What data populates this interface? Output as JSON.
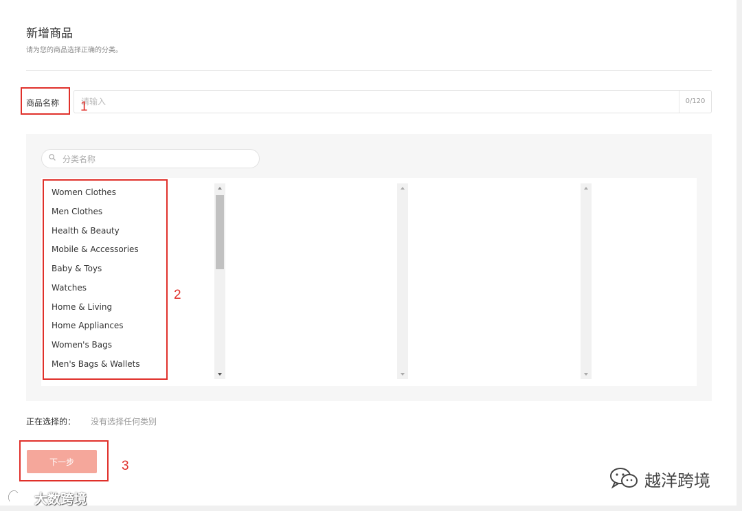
{
  "page": {
    "title": "新增商品",
    "subtitle": "请为您的商品选择正确的分类。"
  },
  "product_name": {
    "label": "商品名称",
    "placeholder": "请输入",
    "value": "",
    "counter": "0/120"
  },
  "category": {
    "search_placeholder": "分类名称",
    "items": [
      {
        "label": "Women Clothes",
        "icon": "chevron-right-icon"
      },
      {
        "label": "Men Clothes",
        "icon": "chevron-right-icon"
      },
      {
        "label": "Health & Beauty",
        "icon": "chevron-right-icon"
      },
      {
        "label": "Mobile & Accessories",
        "icon": "chevron-right-icon"
      },
      {
        "label": "Baby & Toys",
        "icon": "chevron-right-icon"
      },
      {
        "label": "Watches",
        "icon": "chevron-right-icon"
      },
      {
        "label": "Home & Living",
        "icon": "chevron-right-icon"
      },
      {
        "label": "Home Appliances",
        "icon": "chevron-right-icon"
      },
      {
        "label": "Women's Bags",
        "icon": "chevron-right-icon"
      },
      {
        "label": "Men's Bags & Wallets",
        "icon": "chevron-right-icon"
      }
    ]
  },
  "selection": {
    "label": "正在选择的：",
    "value": "没有选择任何类别"
  },
  "actions": {
    "next_label": "下一步",
    "next_color": "#f5a79b"
  },
  "annotations": {
    "color": "#e0302a",
    "labels": [
      "1",
      "2",
      "3"
    ]
  },
  "watermarks": {
    "right": "越洋跨境",
    "left": "大数跨境"
  }
}
